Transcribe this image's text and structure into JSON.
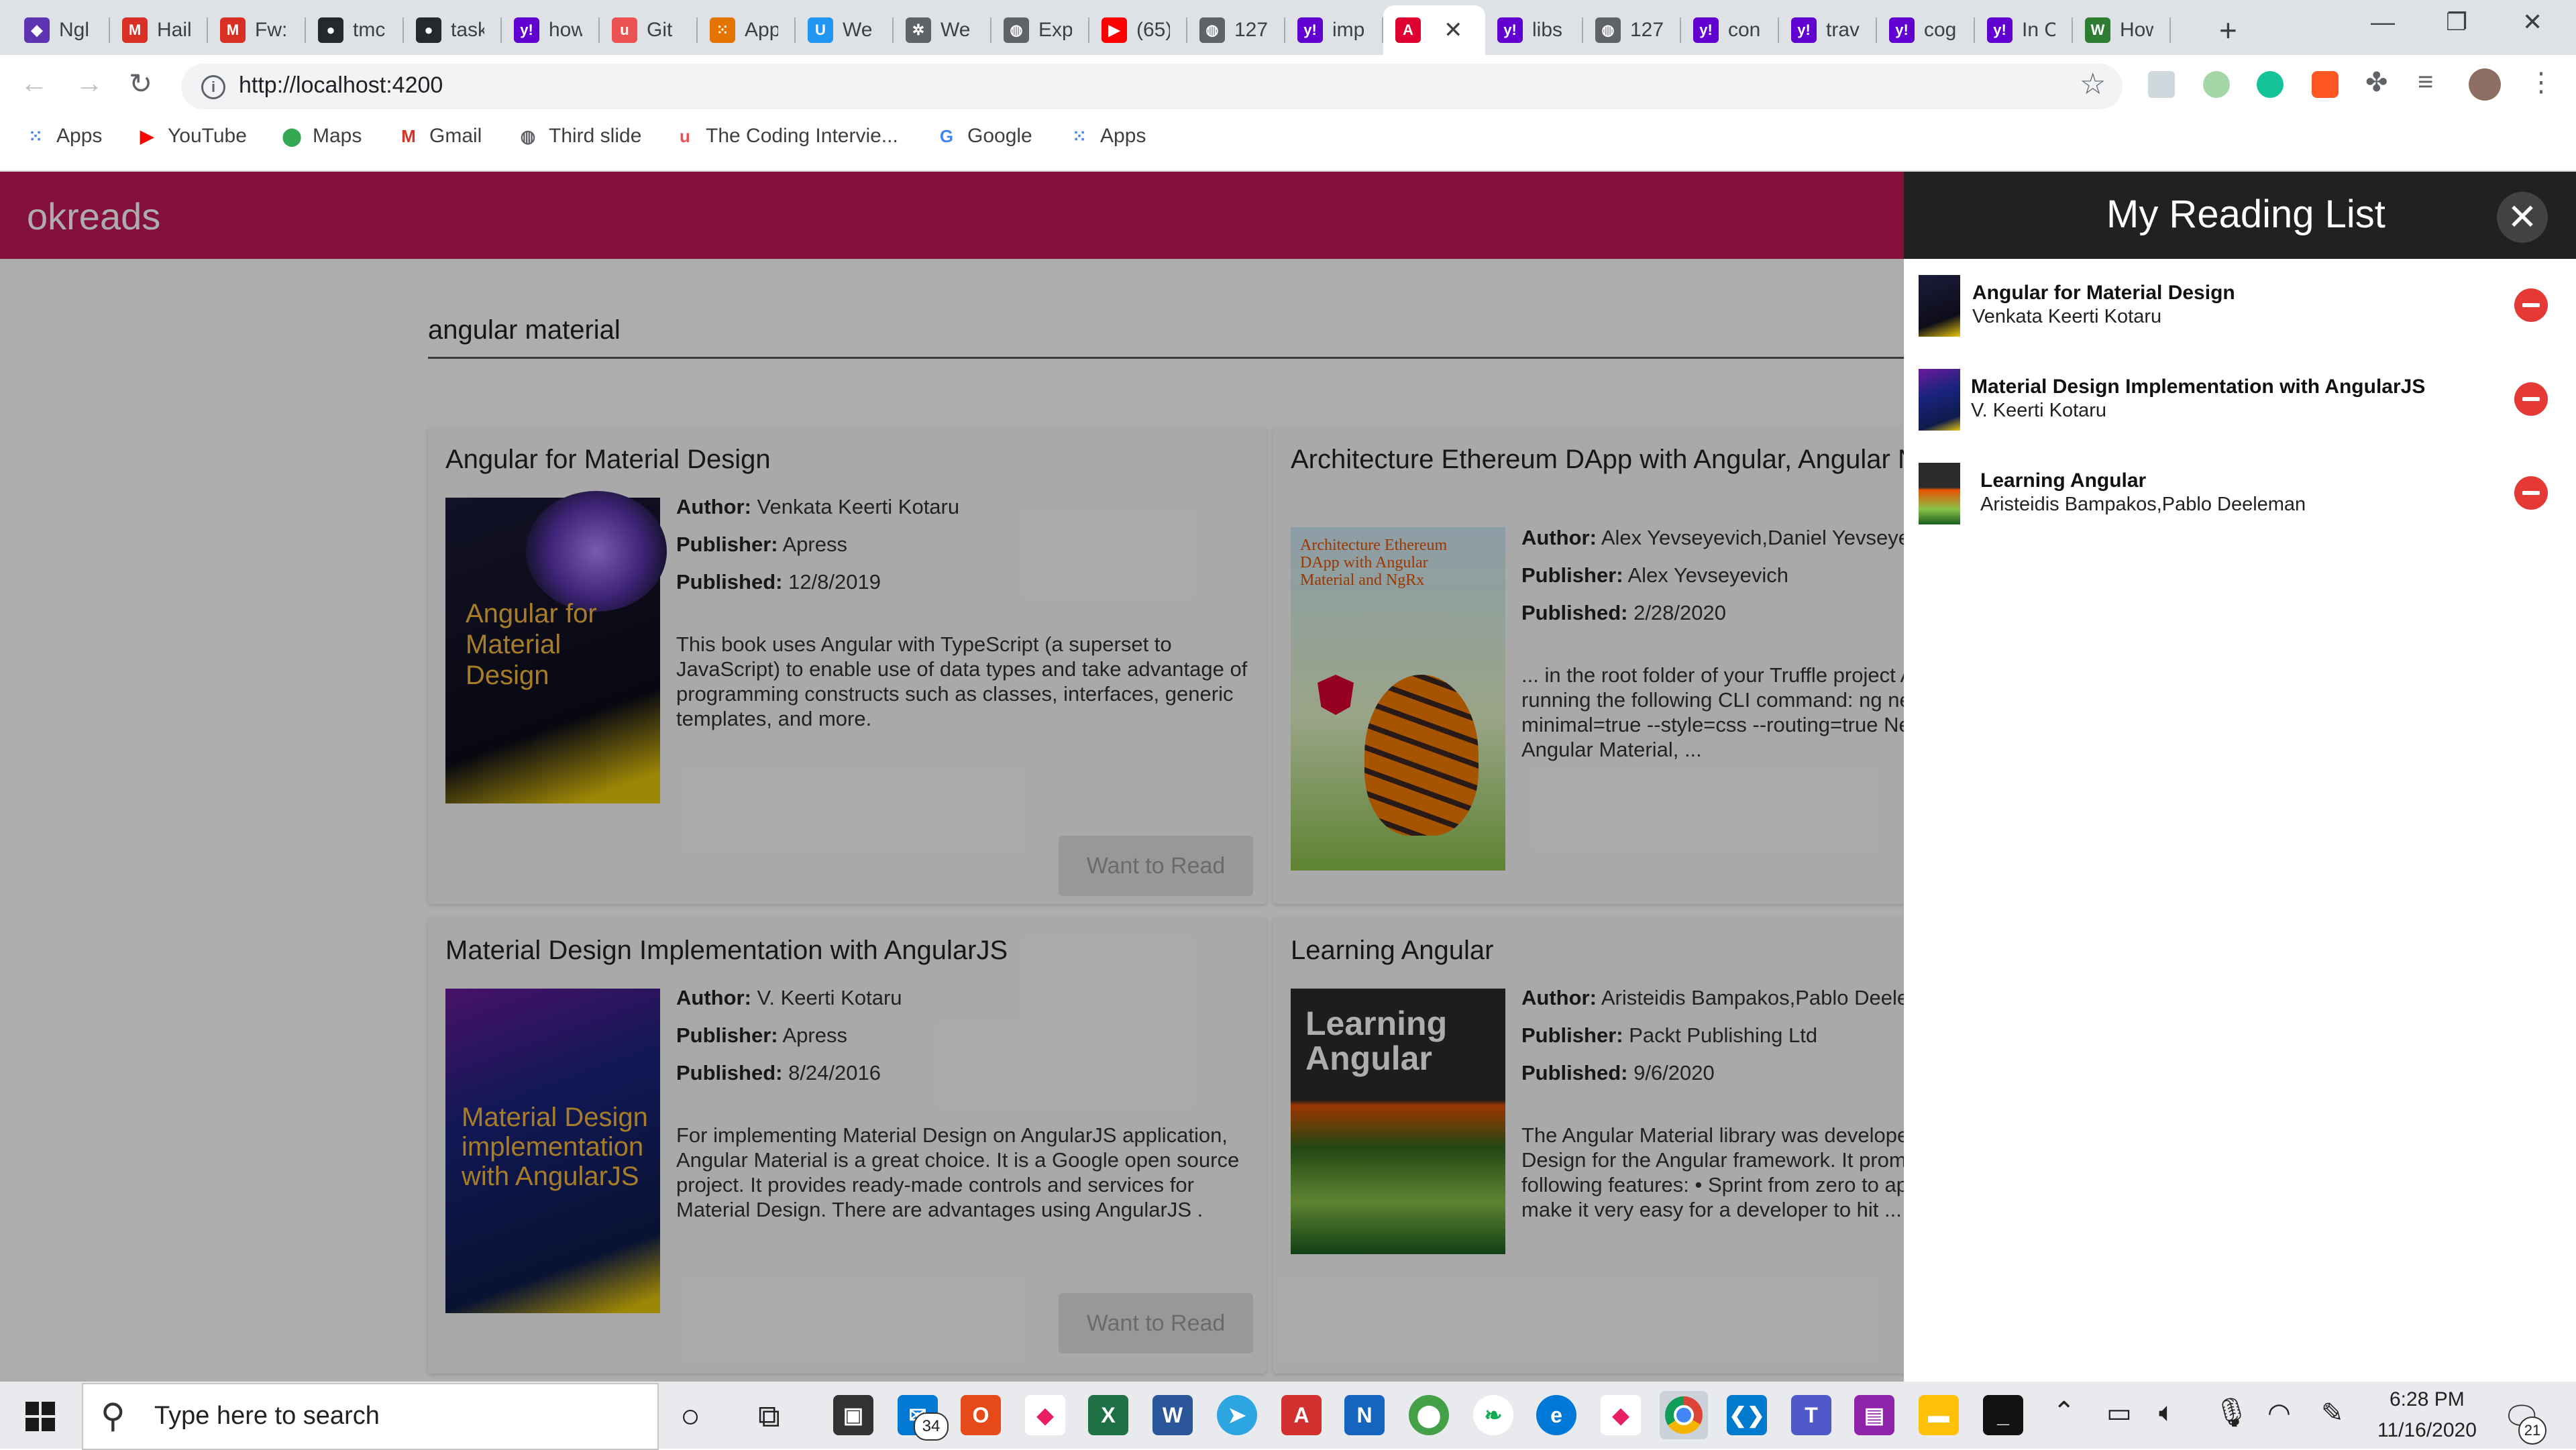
{
  "browser": {
    "tabs": [
      {
        "title": "Ngl",
        "icon": "shield-icon",
        "color": "#5e35b1",
        "glyph": "◆"
      },
      {
        "title": "Hail",
        "icon": "gmail-icon",
        "color": "#d93025",
        "glyph": "M"
      },
      {
        "title": "Fw:",
        "icon": "gmail-icon",
        "color": "#d93025",
        "glyph": "M"
      },
      {
        "title": "tmc",
        "icon": "github-icon",
        "color": "#24292e",
        "glyph": "●"
      },
      {
        "title": "task",
        "icon": "github-icon",
        "color": "#24292e",
        "glyph": "●"
      },
      {
        "title": "how",
        "icon": "yahoo-icon",
        "color": "#6001d2",
        "glyph": "y!"
      },
      {
        "title": "Git",
        "icon": "udemy-icon",
        "color": "#ec5252",
        "glyph": "u"
      },
      {
        "title": "App",
        "icon": "apps-grid-icon",
        "color": "#e37400",
        "glyph": "⁙"
      },
      {
        "title": "We",
        "icon": "webstorm-icon",
        "color": "#2196f3",
        "glyph": "U"
      },
      {
        "title": "We",
        "icon": "puzzle-icon",
        "color": "#5f6368",
        "glyph": "✲"
      },
      {
        "title": "Exp",
        "icon": "globe-icon",
        "color": "#5f6368",
        "glyph": "◍"
      },
      {
        "title": "(65)",
        "icon": "youtube-icon",
        "color": "#ff0000",
        "glyph": "▶"
      },
      {
        "title": "127",
        "icon": "globe-icon",
        "color": "#5f6368",
        "glyph": "◍"
      },
      {
        "title": "imp",
        "icon": "yahoo-icon",
        "color": "#6001d2",
        "glyph": "y!"
      },
      {
        "title": "",
        "icon": "angular-icon",
        "color": "#dd0031",
        "glyph": "A",
        "active": true
      },
      {
        "title": "libs",
        "icon": "yahoo-icon",
        "color": "#6001d2",
        "glyph": "y!"
      },
      {
        "title": "127",
        "icon": "globe-icon",
        "color": "#5f6368",
        "glyph": "◍"
      },
      {
        "title": "con",
        "icon": "yahoo-icon",
        "color": "#6001d2",
        "glyph": "y!"
      },
      {
        "title": "trav",
        "icon": "yahoo-icon",
        "color": "#6001d2",
        "glyph": "y!"
      },
      {
        "title": "cog",
        "icon": "yahoo-icon",
        "color": "#6001d2",
        "glyph": "y!"
      },
      {
        "title": "In C",
        "icon": "yahoo-icon",
        "color": "#6001d2",
        "glyph": "y!"
      },
      {
        "title": "How",
        "icon": "wn-icon",
        "color": "#2e7d32",
        "glyph": "W"
      }
    ],
    "url": "http://localhost:4200",
    "bookmarks": [
      {
        "label": "Apps",
        "icon": "apps-grid-icon",
        "color": "#4285f4",
        "glyph": "⁙"
      },
      {
        "label": "YouTube",
        "icon": "youtube-icon",
        "color": "#ff0000",
        "glyph": "▶"
      },
      {
        "label": "Maps",
        "icon": "maps-pin-icon",
        "color": "#34a853",
        "glyph": "⬤"
      },
      {
        "label": "Gmail",
        "icon": "gmail-icon",
        "color": "#d93025",
        "glyph": "M"
      },
      {
        "label": "Third slide",
        "icon": "globe-icon",
        "color": "#5f6368",
        "glyph": "◍"
      },
      {
        "label": "The Coding Intervie...",
        "icon": "udemy-icon",
        "color": "#ec5252",
        "glyph": "u"
      },
      {
        "label": "Google",
        "icon": "google-icon",
        "color": "#4285f4",
        "glyph": "G"
      },
      {
        "label": "Apps",
        "icon": "apps-grid-icon",
        "color": "#4285f4",
        "glyph": "⁙"
      }
    ]
  },
  "app": {
    "brand": "okreads",
    "search_value": "angular material",
    "books": [
      {
        "title": "Angular for Material Design",
        "author": "Venkata Keerti Kotaru",
        "publisher": "Apress",
        "published": "12/8/2019",
        "description": "This book uses Angular with TypeScript (a superset to JavaScript) to enable use of data types and take advantage of programming constructs such as classes, interfaces, generic templates, and more.",
        "cover_text": "Angular for Material Design",
        "button": "Want to Read"
      },
      {
        "title": "Architecture Ethereum DApp with Angular, Angular Material, and NgRx",
        "title_display": "Architecture Ethereum DApp with Angular, Angular NgRx",
        "author": "Alex Yevseyevich,Daniel Yevseyevich",
        "publisher": "Alex Yevseyevich",
        "published": "2/28/2020",
        "description": "... in the root folder of your Truffle project Angular project by running the following CLI command: ng new skip-install=true -- minimal=true --style=css --routing=true Next, install the Angular Material, ...",
        "cover_text": "Architecture Ethereum DApp with Angular Material and NgRx"
      },
      {
        "title": "Material Design Implementation with AngularJS",
        "author": "V. Keerti Kotaru",
        "publisher": "Apress",
        "published": "8/24/2016",
        "description": "For implementing Material Design on AngularJS application, Angular Material is a great choice. It is a Google open source project. It provides ready-made controls and services for Material Design. There are advantages using AngularJS .",
        "cover_text": "Material Design implementation with AngularJS",
        "button": "Want to Read"
      },
      {
        "title": "Learning Angular",
        "author": "Aristeidis Bampakos,Pablo Deeleman",
        "publisher": "Packt Publishing Ltd",
        "published": "9/6/2020",
        "description": "The Angular Material library was developed to provide Material Design for the Angular framework. It promotes itself with the following features: • Sprint from zero to app: The intention is to make it very easy for a developer to hit ...",
        "cover_text": "Learning Angular"
      }
    ],
    "labels": {
      "author": "Author:",
      "publisher": "Publisher:",
      "published": "Published:"
    }
  },
  "reading_list": {
    "title": "My Reading List",
    "items": [
      {
        "title": "Angular for Material Design",
        "author": "Venkata Keerti Kotaru"
      },
      {
        "title": "Material Design Implementation with AngularJS",
        "author": "V. Keerti Kotaru"
      },
      {
        "title": "Learning Angular",
        "author": "Aristeidis Bampakos,Pablo Deeleman"
      }
    ]
  },
  "taskbar": {
    "search_placeholder": "Type here to search",
    "time": "6:28 PM",
    "date": "11/16/2020",
    "mail_badge": "34",
    "notification_count": "21"
  }
}
